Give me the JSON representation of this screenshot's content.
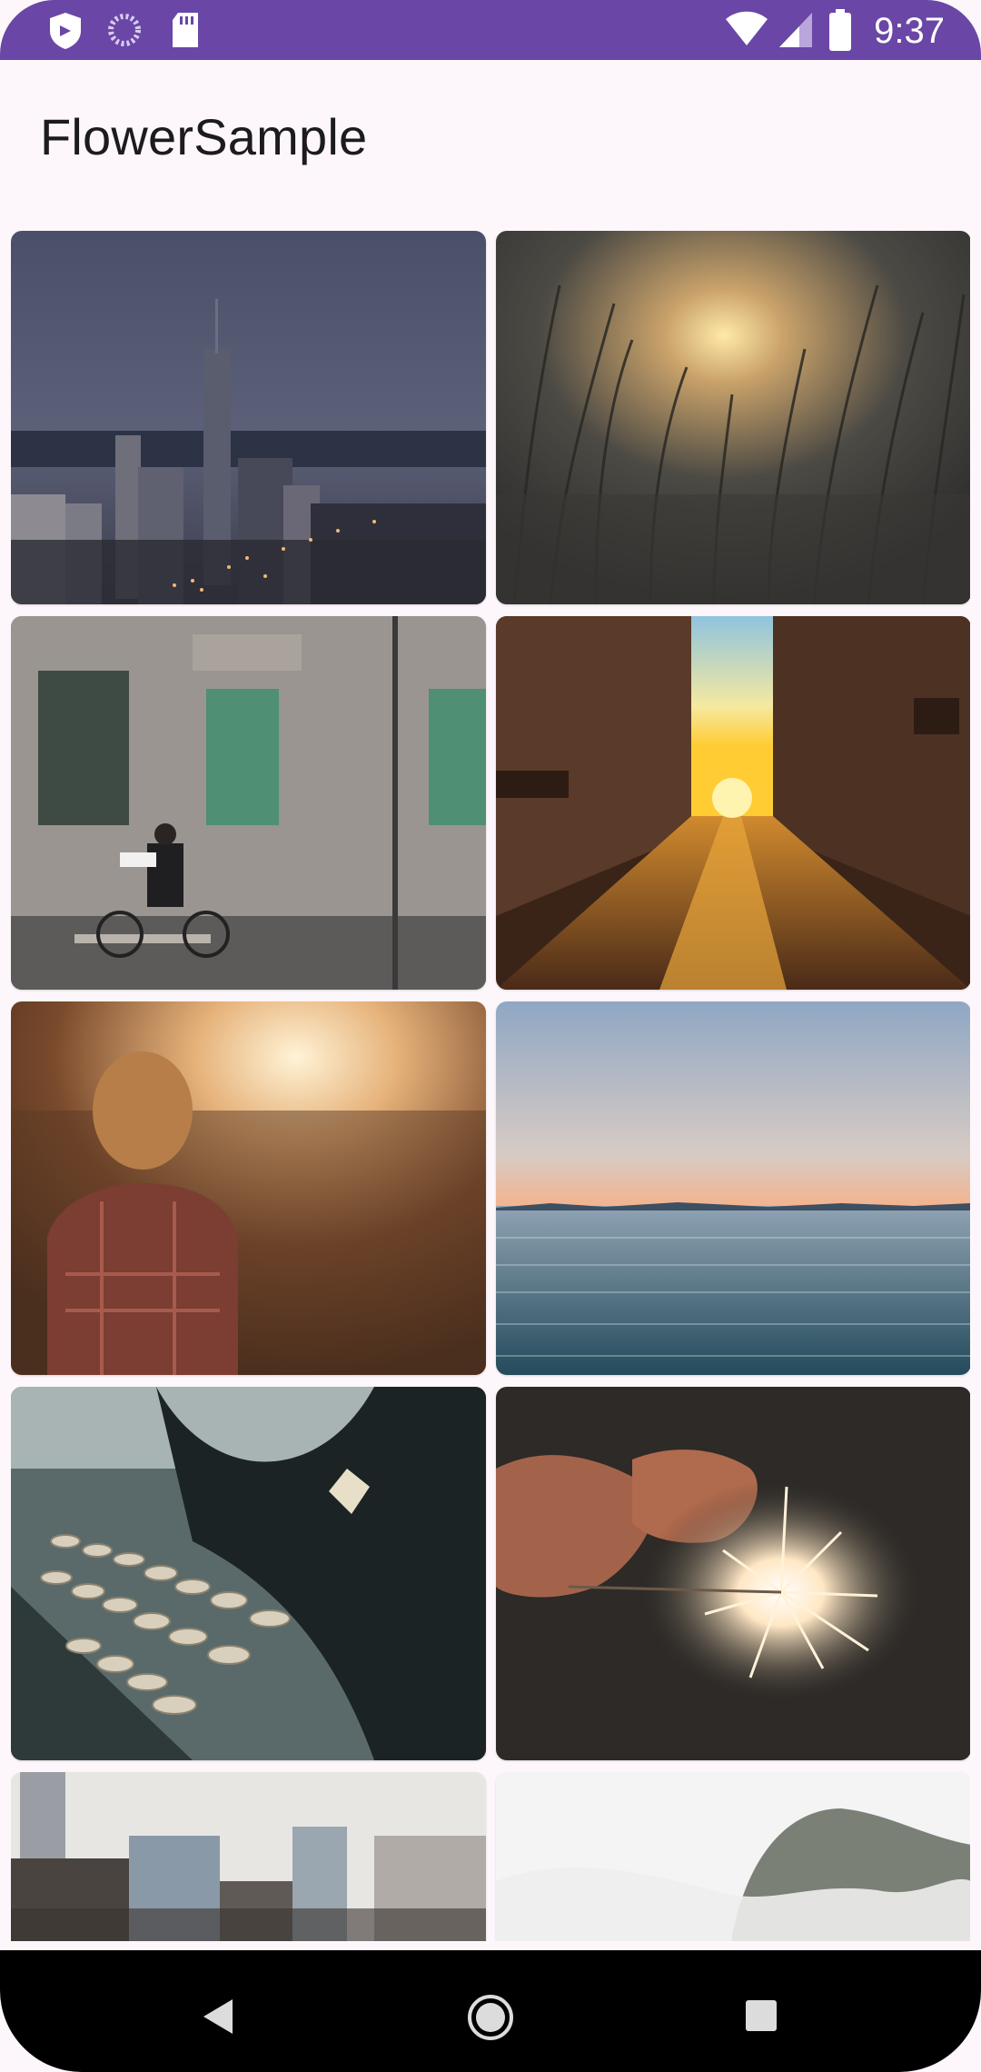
{
  "status_bar": {
    "time": "9:37",
    "left_icons": [
      "shield-icon",
      "loading-ring-icon",
      "sd-card-icon"
    ],
    "right_icons": [
      "wifi-icon",
      "signal-icon",
      "battery-icon"
    ]
  },
  "app_bar": {
    "title": "FlowerSample"
  },
  "gallery": {
    "photos": [
      {
        "subject": "city skyline at dusk"
      },
      {
        "subject": "sunset through tall grass"
      },
      {
        "subject": "cyclist by old building"
      },
      {
        "subject": "sunset street"
      },
      {
        "subject": "woman in sunset"
      },
      {
        "subject": "calm sea at dusk"
      },
      {
        "subject": "vintage typewriter"
      },
      {
        "subject": "sparkler in hands"
      },
      {
        "subject": "city buildings"
      },
      {
        "subject": "misty mountain"
      }
    ]
  },
  "nav_bar": {
    "buttons": [
      "back-button",
      "home-button",
      "recents-button"
    ]
  },
  "colors": {
    "status_bar": "#6a46a6",
    "background": "#fdf7fb"
  }
}
